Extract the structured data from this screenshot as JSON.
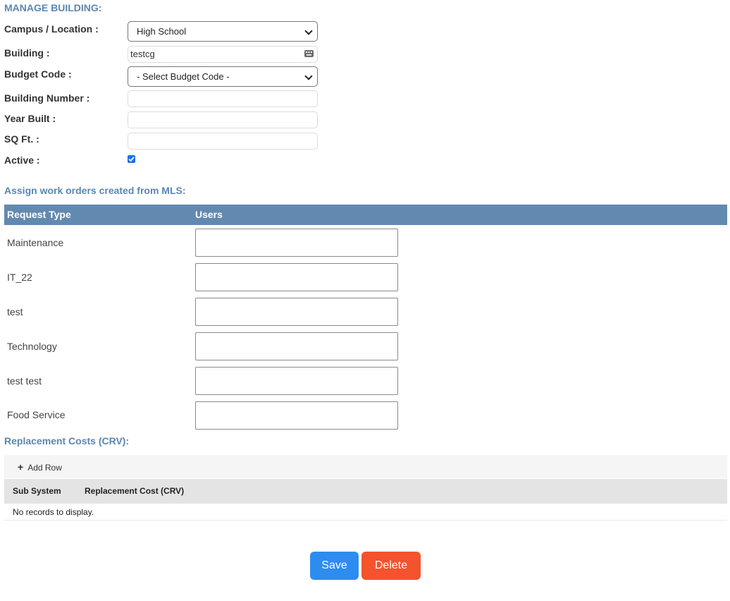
{
  "header": {
    "title": "MANAGE BUILDING:"
  },
  "form": {
    "campus": {
      "label": "Campus / Location :",
      "value": "High School"
    },
    "building": {
      "label": "Building :",
      "value": "testcg",
      "icon": "keyboard-icon"
    },
    "budget_code": {
      "label": "Budget Code :",
      "value": "- Select Budget Code -"
    },
    "building_number": {
      "label": "Building Number :",
      "value": ""
    },
    "year_built": {
      "label": "Year Built :",
      "value": ""
    },
    "sq_ft": {
      "label": "SQ Ft. :",
      "value": ""
    },
    "active": {
      "label": "Active :",
      "checked": true
    }
  },
  "assign": {
    "title": "Assign work orders created from MLS:",
    "columns": [
      "Request Type",
      "Users"
    ],
    "rows": [
      {
        "request_type": "Maintenance",
        "users": ""
      },
      {
        "request_type": "IT_22",
        "users": ""
      },
      {
        "request_type": "test",
        "users": ""
      },
      {
        "request_type": "Technology",
        "users": ""
      },
      {
        "request_type": "test test",
        "users": ""
      },
      {
        "request_type": "Food Service",
        "users": ""
      }
    ]
  },
  "crv": {
    "title": "Replacement Costs (CRV):",
    "add_row_label": "Add Row",
    "columns": [
      "Sub System",
      "Replacement Cost (CRV)"
    ],
    "empty_message": "No records to display."
  },
  "actions": {
    "save_label": "Save",
    "delete_label": "Delete"
  },
  "colors": {
    "accent": "#5b86b0",
    "header_bg": "#6289b0",
    "save": "#2d8cf0",
    "delete": "#f5522e",
    "checkbox": "#1a73e8"
  }
}
